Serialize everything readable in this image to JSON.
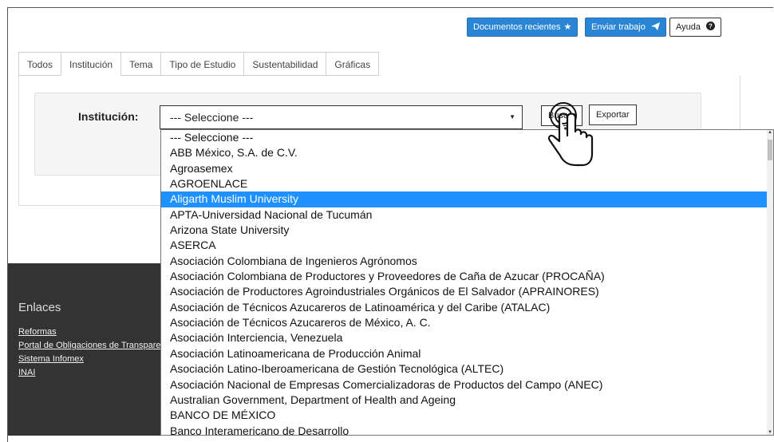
{
  "header": {
    "recent_docs": "Documentos recientes",
    "send_work": "Enviar trabajo",
    "help": "Ayuda"
  },
  "tabs": [
    {
      "label": "Todos"
    },
    {
      "label": "Institución"
    },
    {
      "label": "Tema"
    },
    {
      "label": "Tipo de Estudio"
    },
    {
      "label": "Sustentabilidad"
    },
    {
      "label": "Gráficas"
    }
  ],
  "form": {
    "label": "Institución:",
    "selected": "--- Seleccione ---",
    "search_label": "Buscar",
    "export_label": "Exportar"
  },
  "dropdown": {
    "options": [
      "--- Seleccione ---",
      "ABB México, S.A. de C.V.",
      "Agroasemex",
      "AGROENLACE",
      "Aligarth Muslim University",
      "APTA-Universidad Nacional de Tucumán",
      "Arizona State University",
      "ASERCA",
      "Asociación Colombiana de Ingenieros Agrónomos",
      "Asociación Colombiana de Productores y Proveedores de Caña de Azucar (PROCAÑA)",
      "Asociación de Productores Agroindustriales Orgánicos de El Salvador (APRAINORES)",
      "Asociación de Técnicos Azucareros de Latinoamérica y del Caribe (ATALAC)",
      "Asociación de Técnicos Azucareros de México, A. C.",
      "Asociación Interciencia, Venezuela",
      "Asociación Latinoamericana de Producción Animal",
      "Asociación Latino-Iberoamericana de Gestión Tecnológica (ALTEC)",
      "Asociación Nacional de Empresas Comercializadoras de Productos del Campo (ANEC)",
      "Australian Government, Department of Health and Ageing",
      "BANCO DE MÉXICO",
      "Banco Interamericano de Desarrollo"
    ],
    "highlighted": "Aligarth Muslim University"
  },
  "footer": {
    "heading": "Enlaces",
    "links": [
      "Reformas",
      "Portal de Obligaciones de Transpare",
      "Sistema Infomex",
      "INAI"
    ]
  },
  "colors": {
    "accent": "#2a86d4",
    "highlight": "#1e90ff",
    "footer_bg": "#333334"
  }
}
